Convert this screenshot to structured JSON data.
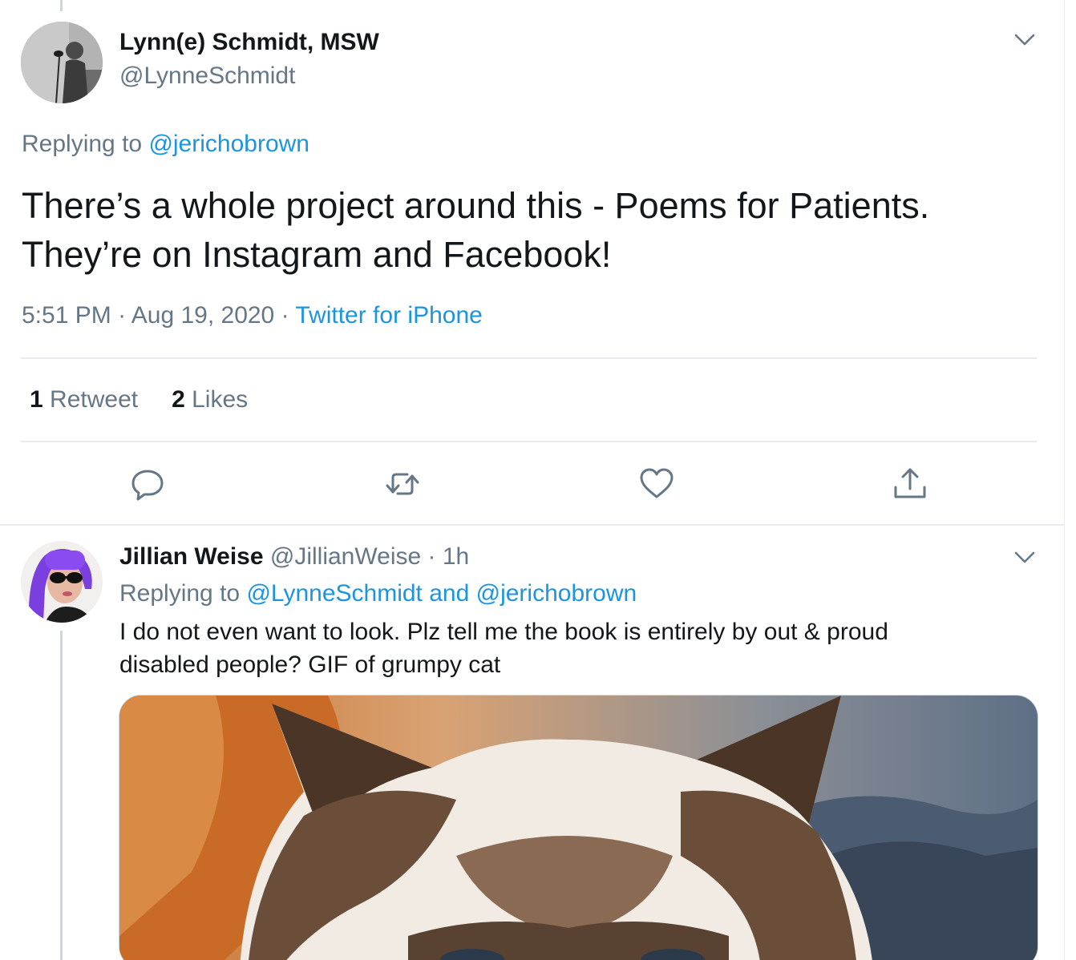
{
  "main_tweet": {
    "display_name": "Lynn(e) Schmidt, MSW",
    "handle": "@LynneSchmidt",
    "replying_prefix": "Replying to ",
    "replying_to": "@jerichobrown",
    "text_lines": [
      "There’s a whole project around this - Poems for Patients.",
      "They’re on Instagram and Facebook!"
    ],
    "time": "5:51 PM",
    "date": "Aug 19, 2020",
    "meta_sep": " · ",
    "source": "Twitter for iPhone",
    "retweet_count": "1",
    "retweet_label": "Retweet",
    "like_count": "2",
    "like_label": "Likes"
  },
  "reply_tweet": {
    "display_name": "Jillian Weise",
    "handle": "@JillianWeise",
    "time_sep": " · ",
    "time": "1h",
    "replying_prefix": "Replying to ",
    "replying_to_1": "@LynneSchmidt",
    "and": " and ",
    "replying_to_2": "@jerichobrown",
    "text_lines": [
      "I do not even want to look. Plz tell me the book is entirely by out & proud",
      "disabled people? GIF of grumpy cat"
    ]
  },
  "colors": {
    "link": "#1b95e0",
    "secondary_text": "#657786",
    "primary_text": "#14171a",
    "divider": "#e6ecf0"
  },
  "icons": {
    "caret": "chevron-down-icon",
    "reply": "reply-icon",
    "retweet": "retweet-icon",
    "like": "heart-icon",
    "share": "share-icon"
  }
}
